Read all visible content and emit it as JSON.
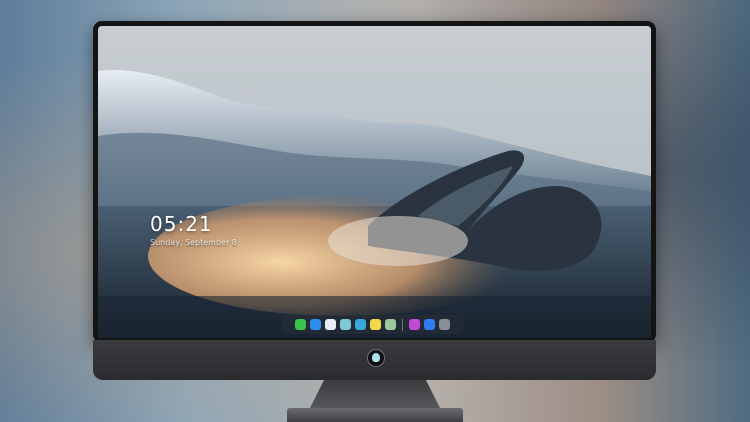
{
  "lock_screen": {
    "time": "05:21",
    "date": "Sunday, September 8"
  },
  "dock": {
    "apps": [
      {
        "name": "messages-icon",
        "glyph": "",
        "color": "#3dc24c"
      },
      {
        "name": "finder-icon",
        "glyph": "",
        "color": "#2e8cf0"
      },
      {
        "name": "safari-icon",
        "glyph": "",
        "color": "#e8eef5"
      },
      {
        "name": "photos-icon",
        "glyph": "",
        "color": "#7dcad6"
      },
      {
        "name": "video-icon",
        "glyph": "",
        "color": "#39a8d8"
      },
      {
        "name": "notes-icon",
        "glyph": "",
        "color": "#f5d84a"
      },
      {
        "name": "preview-icon",
        "glyph": "",
        "color": "#9bc9a0"
      },
      {
        "name": "music-icon",
        "glyph": "",
        "color": "#c04ad6"
      },
      {
        "name": "app-store-icon",
        "glyph": "",
        "color": "#2f7df0"
      },
      {
        "name": "camera-icon",
        "glyph": "",
        "color": "#8a8f96"
      }
    ]
  }
}
